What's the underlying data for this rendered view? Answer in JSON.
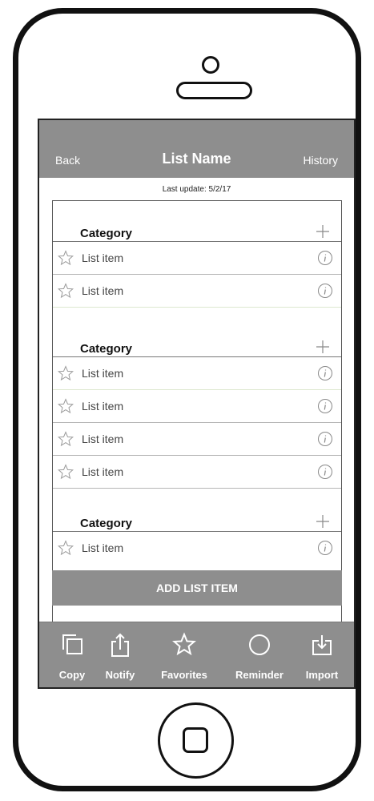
{
  "nav": {
    "back": "Back",
    "title": "List Name",
    "history": "History"
  },
  "last_update": "Last update: 5/2/17",
  "categories": [
    {
      "label": "Category",
      "items": [
        "List item",
        "List item"
      ]
    },
    {
      "label": "Category",
      "items": [
        "List item",
        "List item",
        "List item",
        "List item"
      ]
    },
    {
      "label": "Category",
      "items": [
        "List item"
      ]
    }
  ],
  "add_button": "ADD LIST ITEM",
  "tabs": [
    {
      "label": "Copy",
      "icon": "copy-icon"
    },
    {
      "label": "Notify",
      "icon": "share-icon"
    },
    {
      "label": "Favorites",
      "icon": "star-icon"
    },
    {
      "label": "Reminder",
      "icon": "circle-icon"
    },
    {
      "label": "Import",
      "icon": "import-icon"
    }
  ],
  "colors": {
    "bar_gray": "#8e8e8e",
    "frame": "#111111"
  }
}
